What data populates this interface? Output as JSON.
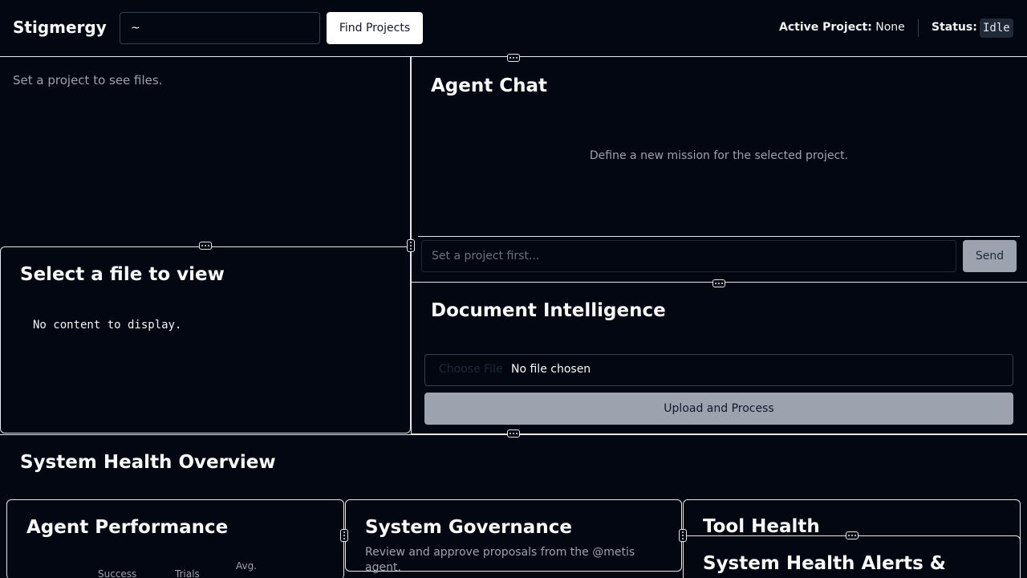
{
  "header": {
    "app_title": "Stigmergy",
    "path_input_value": "~",
    "find_button": "Find Projects",
    "active_project_label": "Active Project:",
    "active_project_value": "None",
    "status_label": "Status:",
    "status_value": "Idle"
  },
  "file_list": {
    "empty_text": "Set a project to see files."
  },
  "file_viewer": {
    "title": "Select a file to view",
    "content": "No content to display."
  },
  "agent_chat": {
    "title": "Agent Chat",
    "hint": "Define a new mission for the selected project.",
    "input_placeholder": "Set a project first...",
    "send_button": "Send"
  },
  "document_intelligence": {
    "title": "Document Intelligence",
    "choose_file_button": "Choose File",
    "no_file_label": "No file chosen",
    "upload_button": "Upload and Process"
  },
  "system_health": {
    "title": "System Health Overview",
    "agent_performance": {
      "title": "Agent Performance",
      "columns": [
        "Success",
        "Trials",
        "Avg."
      ]
    },
    "governance": {
      "title": "System Governance",
      "description": "Review and approve proposals from the @metis agent."
    },
    "tool_health": {
      "title": "Tool Health"
    },
    "alerts": {
      "title": "System Health Alerts &"
    }
  },
  "colors": {
    "background": "#030712",
    "border": "#e5e7eb",
    "muted_text": "#9ca3af",
    "disabled_button": "#9ca3af"
  }
}
